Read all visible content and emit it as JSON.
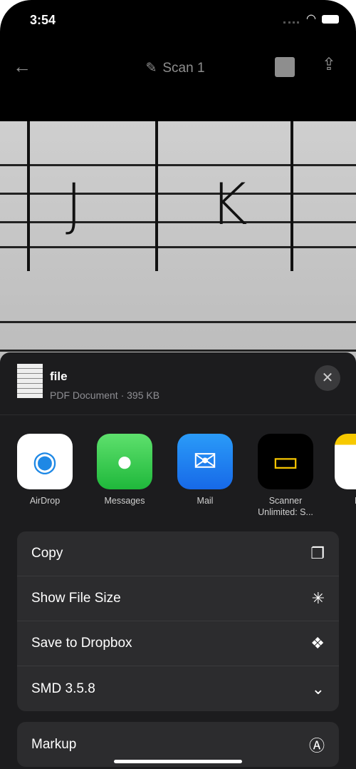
{
  "status": {
    "time": "3:54"
  },
  "nav": {
    "title": "Scan 1"
  },
  "scan": {
    "letters": [
      "J",
      "K"
    ]
  },
  "sheet": {
    "file_name": "file",
    "file_meta": "PDF Document · 395 KB",
    "apps": [
      {
        "label": "AirDrop",
        "icon": "airdrop-icon"
      },
      {
        "label": "Messages",
        "icon": "messages-icon"
      },
      {
        "label": "Mail",
        "icon": "mail-icon"
      },
      {
        "label": "Scanner Unlimited: S...",
        "icon": "scanner-icon"
      },
      {
        "label": "N",
        "icon": "notes-icon"
      }
    ],
    "actions": [
      {
        "label": "Copy",
        "icon": "copy-icon"
      },
      {
        "label": "Show File Size",
        "icon": "sparkle-icon"
      },
      {
        "label": "Save to Dropbox",
        "icon": "dropbox-icon"
      },
      {
        "label": "SMD 3.5.8",
        "icon": "chevron-down-circle-icon"
      }
    ],
    "actions2": [
      {
        "label": "Markup",
        "icon": "markup-icon"
      }
    ]
  }
}
